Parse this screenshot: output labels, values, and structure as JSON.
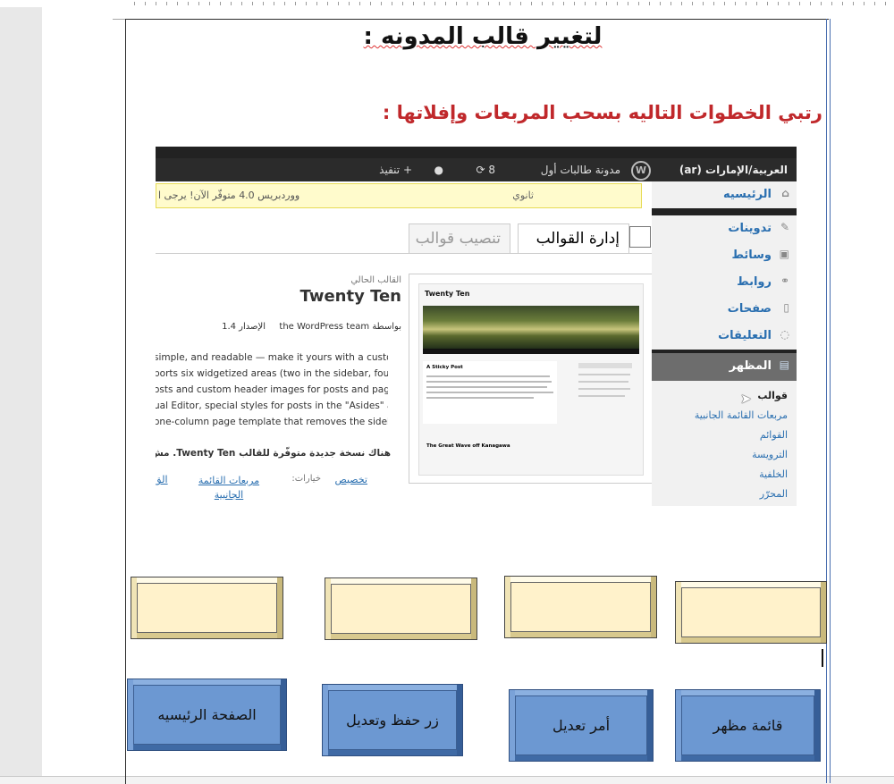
{
  "document": {
    "title": "لتغيير قالب المدونه :",
    "subtitle": "رتبي الخطوات التاليه بسحب المربعات وإفلاتها :"
  },
  "screenshot": {
    "adminbar": {
      "language": "العربية/الإمارات (ar)",
      "blog_name": "مدونة طالبات أول",
      "updates": "8",
      "new": "+ تنفيذ"
    },
    "sidebar": {
      "items": [
        {
          "label": "الرئيسيه",
          "icon": "home-icon"
        },
        {
          "label": "تدوينات",
          "icon": "pin-icon"
        },
        {
          "label": "وسائط",
          "icon": "media-icon"
        },
        {
          "label": "روابط",
          "icon": "link-icon"
        },
        {
          "label": "صفحات",
          "icon": "page-icon"
        },
        {
          "label": "التعليقات",
          "icon": "comment-icon"
        },
        {
          "label": "المظهر",
          "icon": "appearance-icon"
        }
      ],
      "submenu": [
        "قوالب",
        "مربعات القائمة الجانبية",
        "القوائم",
        "الترويسة",
        "الخلفية",
        "المحرّر"
      ]
    },
    "notice": {
      "left_text": "ووردبريس 4.0 متوفّر الآن! يرجى ا",
      "right_text": "ثانوي"
    },
    "tabs": {
      "active": "إدارة القوالب",
      "inactive": "تنصيب قوالب"
    },
    "theme": {
      "current_label": "القالب الحالي",
      "name": "Twenty Ten",
      "author_line": "بواسطة the WordPress team",
      "version": "الإصدار 1.4",
      "description": [
        "simple, and readable — make it yours with a custom",
        "ports six widgetized areas (two in the sidebar, four in",
        "osts and custom header images for posts and pages).",
        "ual Editor, special styles for posts in the \"Asides\" and",
        "one-column page template that removes the sidebar"
      ],
      "update_notice": "هناك نسخة جديدة متوفّرة للقالب Twenty Ten. مش",
      "options_label": "خيارات:",
      "option_links": [
        "تخصيص",
        "مربعات القائمة الجانبية",
        "الق"
      ]
    },
    "thumbnail": {
      "site_title": "Twenty Ten",
      "sticky_post": "A Sticky Post",
      "great_wave": "The Great Wave off Kanagawa"
    }
  },
  "answer_boxes": [
    "",
    "",
    "",
    ""
  ],
  "step_boxes": [
    {
      "label": "الصفحة الرئيسيه"
    },
    {
      "label": "زر حفظ وتعديل"
    },
    {
      "label": "أمر تعديل"
    },
    {
      "label": "قائمة مظهر"
    }
  ]
}
